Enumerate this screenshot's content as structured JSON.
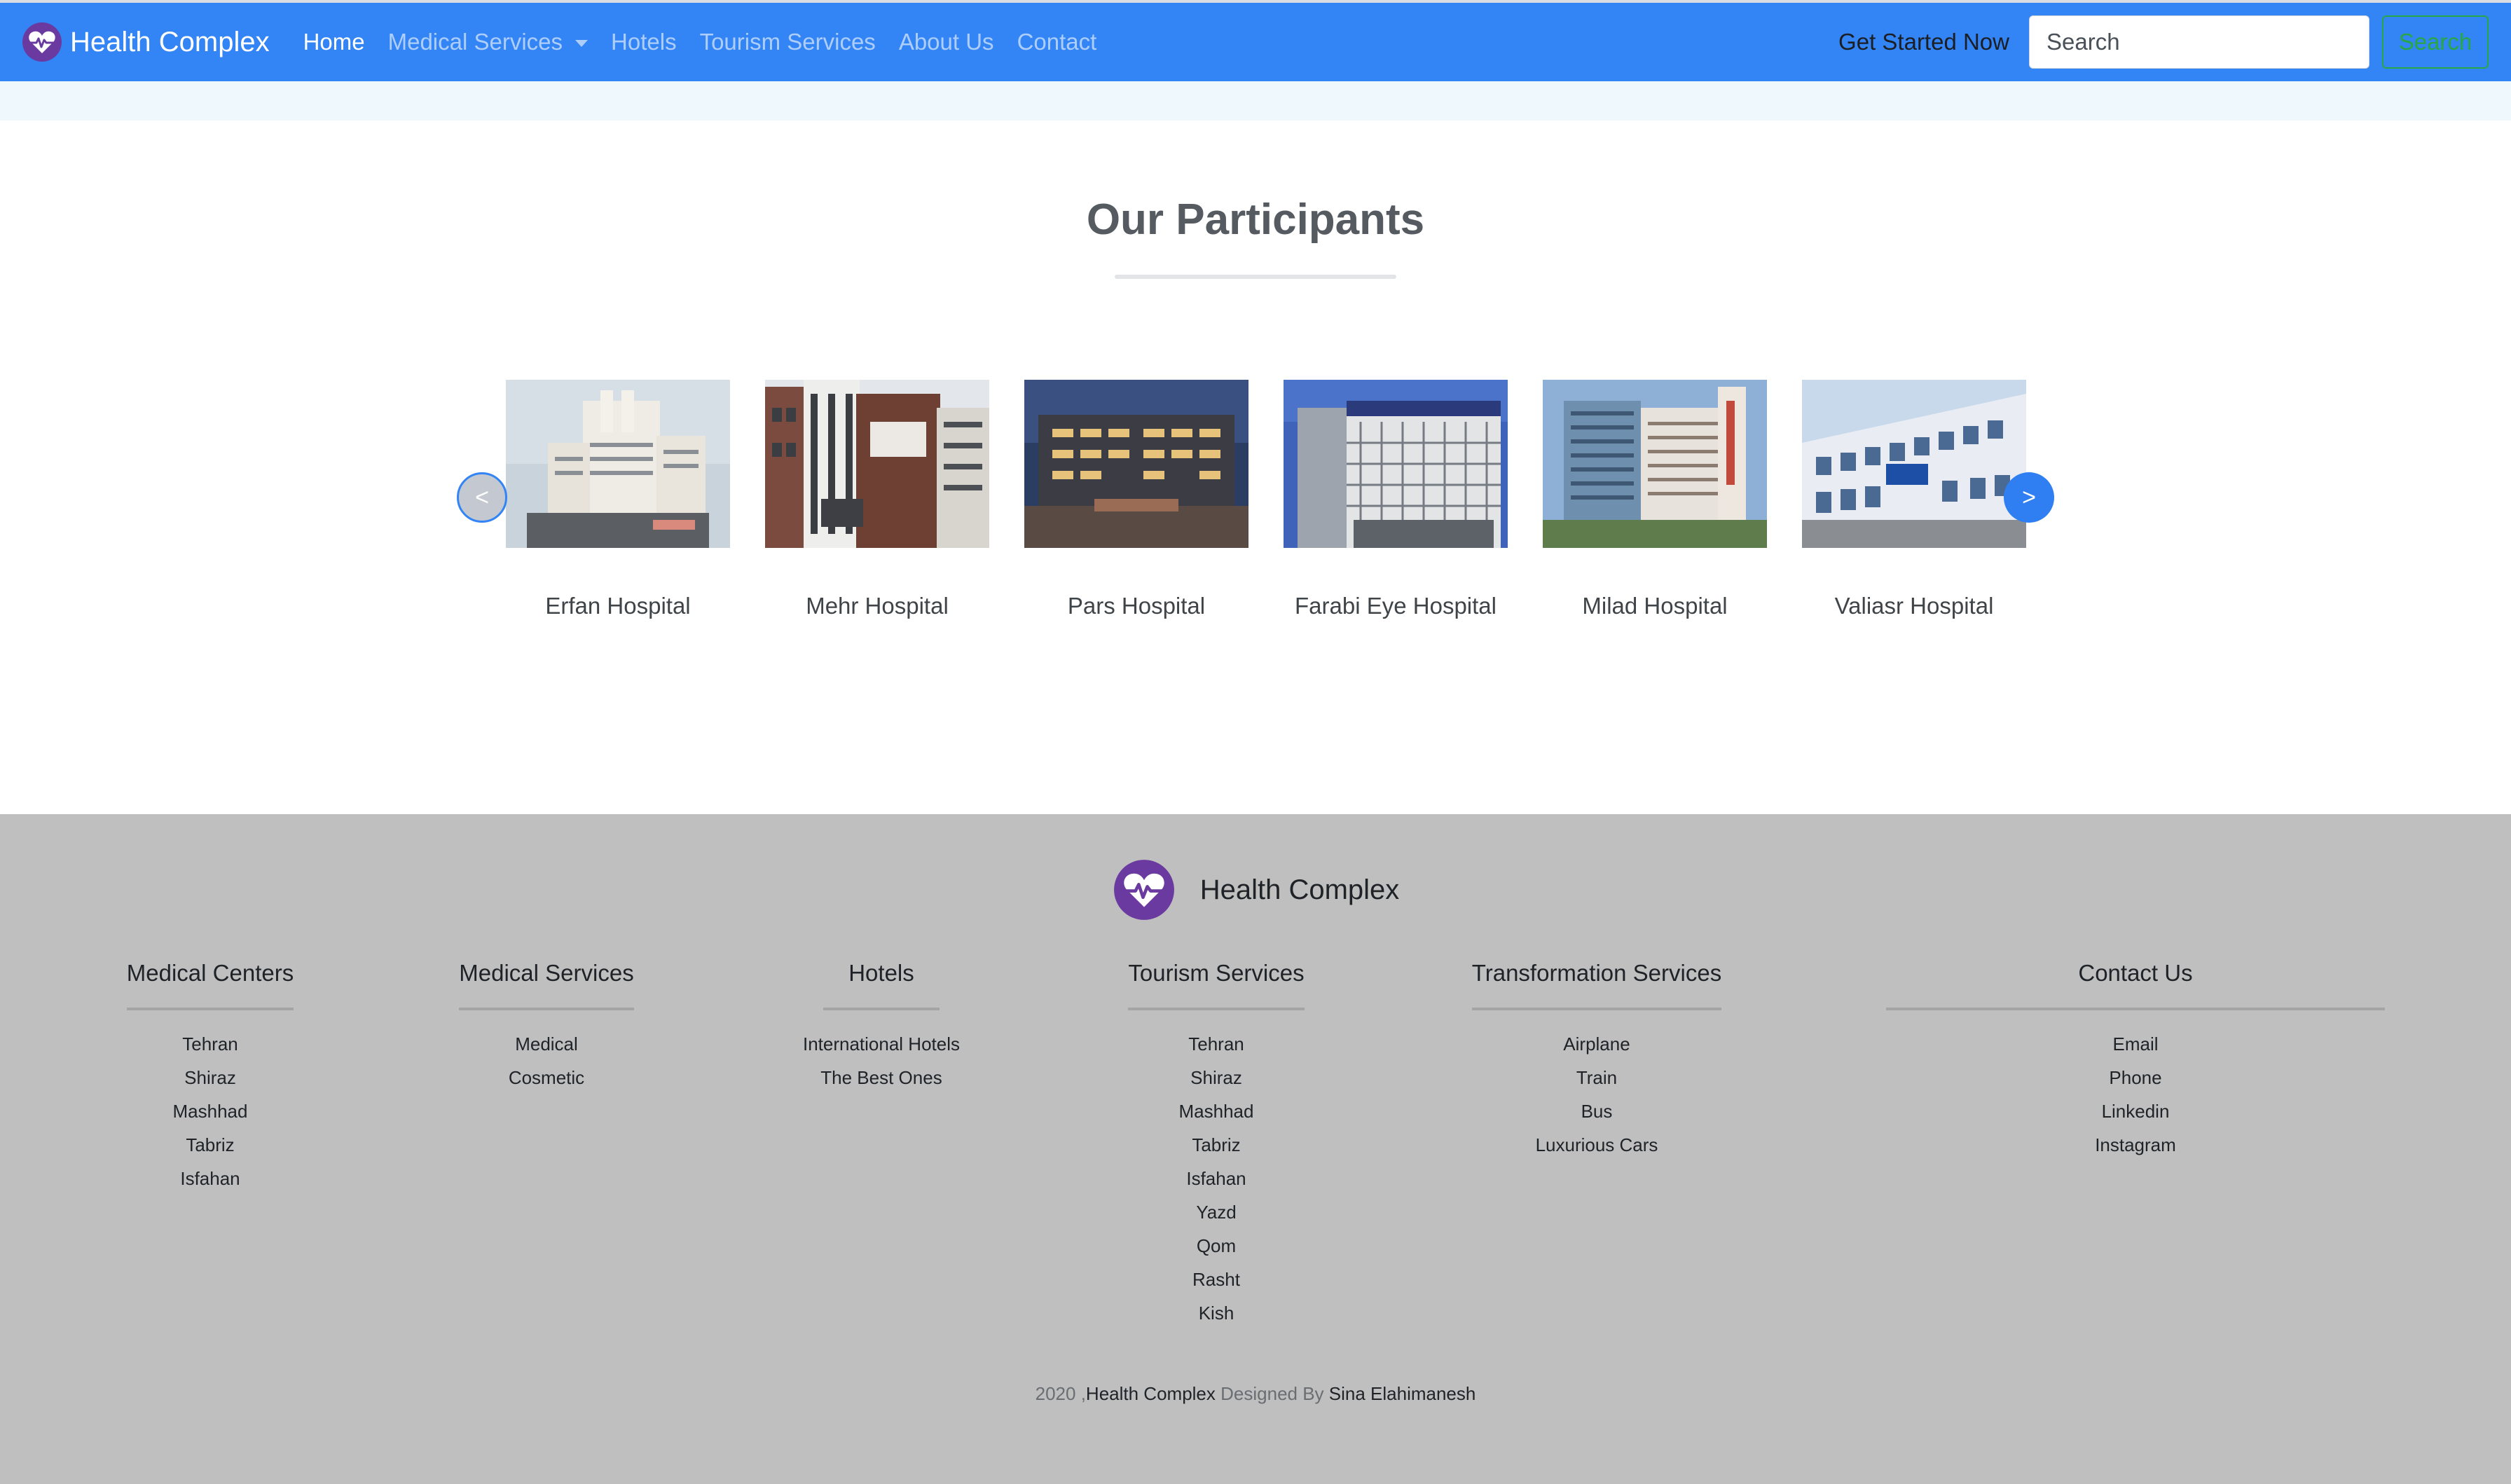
{
  "navbar": {
    "brand": "Health Complex",
    "links": [
      {
        "label": "Home"
      },
      {
        "label": "Medical Services"
      },
      {
        "label": "Hotels"
      },
      {
        "label": "Tourism Services"
      },
      {
        "label": "About Us"
      },
      {
        "label": "Contact"
      }
    ],
    "get_started": "Get Started Now",
    "search_placeholder": "Search",
    "search_button": "Search",
    "colors": {
      "bar": "#3384f4",
      "search_button": "#28a745"
    }
  },
  "participants": {
    "title": "Our Participants",
    "prev_label": "<",
    "next_label": ">",
    "hospitals": [
      {
        "name": "Erfan Hospital"
      },
      {
        "name": "Mehr Hospital"
      },
      {
        "name": "Pars Hospital"
      },
      {
        "name": "Farabi Eye Hospital"
      },
      {
        "name": "Milad Hospital"
      },
      {
        "name": "Valiasr Hospital"
      }
    ]
  },
  "footer": {
    "brand": "Health Complex",
    "columns": [
      {
        "title": "Medical Centers",
        "items": [
          "Tehran",
          "Shiraz",
          "Mashhad",
          "Tabriz",
          "Isfahan"
        ]
      },
      {
        "title": "Medical Services",
        "items": [
          "Medical",
          "Cosmetic"
        ]
      },
      {
        "title": "Hotels",
        "items": [
          "International Hotels",
          "The Best Ones"
        ]
      },
      {
        "title": "Tourism Services",
        "items": [
          "Tehran",
          "Shiraz",
          "Mashhad",
          "Tabriz",
          "Isfahan",
          "Yazd",
          "Qom",
          "Rasht",
          "Kish"
        ]
      },
      {
        "title": "Transformation Services",
        "items": [
          "Airplane",
          "Train",
          "Bus",
          "Luxurious Cars"
        ]
      },
      {
        "title": "Contact Us",
        "items": [
          "Email",
          "Phone",
          "Linkedin",
          "Instagram"
        ]
      }
    ],
    "copyright": {
      "year": "2020 ,",
      "brand": "Health Complex",
      "designed_by": " Designed By ",
      "author": "Sina Elahimanesh"
    }
  }
}
